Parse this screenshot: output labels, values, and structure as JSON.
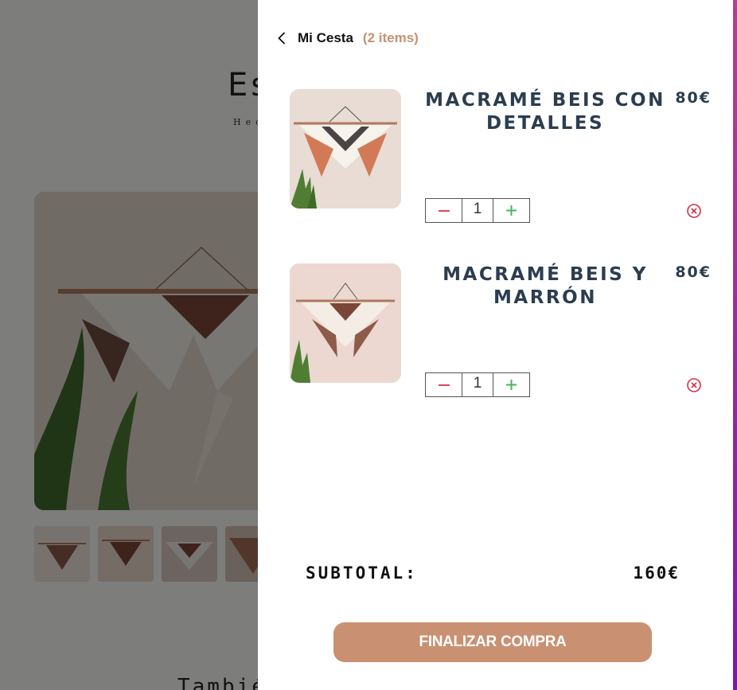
{
  "background": {
    "title": "Es",
    "subtitle": "Hecl",
    "related_heading": "Tambié"
  },
  "cart": {
    "title": "Mi Cesta",
    "count_label": "(2 items)",
    "items": [
      {
        "name": "Macramé beis con detalles",
        "price": "80€",
        "quantity": "1",
        "image": "macrame-terracotta-image"
      },
      {
        "name": "Macramé beis y marrón",
        "price": "80€",
        "quantity": "1",
        "image": "macrame-brown-image"
      }
    ],
    "subtotal_label": "SUBTOTAL:",
    "subtotal_value": "160€",
    "checkout_label": "FINALIZAR COMPRA"
  },
  "colors": {
    "accent": "#c99072",
    "heading": "#2b3d4f",
    "minus": "#e0445e",
    "plus": "#4db35a",
    "remove": "#d0304a"
  },
  "icons": [
    "chevron-left-icon",
    "minus-icon",
    "plus-icon",
    "remove-circle-icon"
  ]
}
